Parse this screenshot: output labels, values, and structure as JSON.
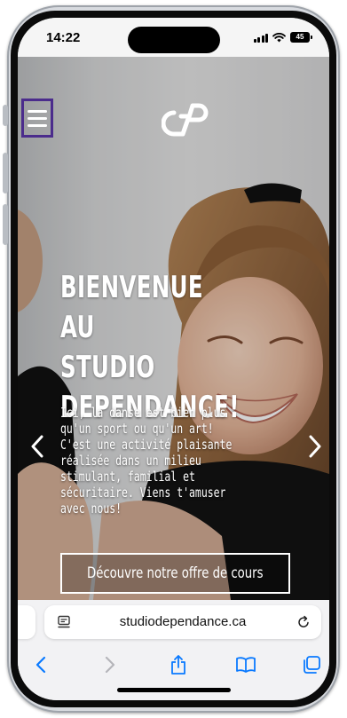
{
  "status_bar": {
    "time": "14:22",
    "battery": "45"
  },
  "hero": {
    "headline_lines": [
      "BIENVENUE AU",
      "STUDIO",
      "DEPENDANCE!"
    ],
    "intro_lines": [
      "Ici, la danse est bien plus",
      "qu'un sport ou qu'un art!",
      "C'est une activité plaisante",
      "réalisée dans un milieu",
      "stimulant, familial et",
      "sécuritaire. Viens t'amuser",
      "avec nous!"
    ],
    "cta_label": "Découvre notre offre de cours"
  },
  "browser": {
    "url": "studiodependance.ca"
  },
  "icons": {
    "menu": "hamburger-menu-icon",
    "logo": "studio-logo",
    "prev": "chevron-left-icon",
    "next": "chevron-right-icon",
    "reader": "reader-mode-icon",
    "reload": "reload-icon",
    "back": "back-arrow-icon",
    "forward": "forward-arrow-icon",
    "share": "share-icon",
    "bookmarks": "book-icon",
    "tabs": "tabs-icon"
  },
  "colors": {
    "accent": "#4b2c8c",
    "safari_blue": "#0a7aff",
    "disabled": "#b5b5ba"
  }
}
